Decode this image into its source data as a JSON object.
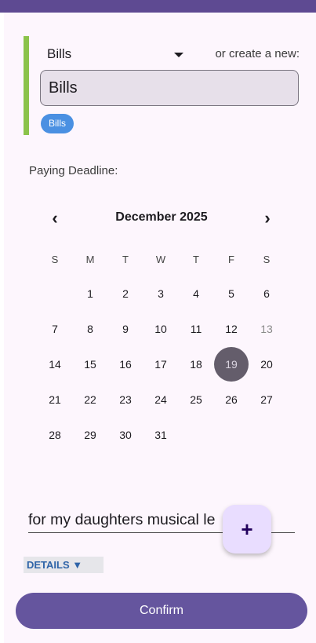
{
  "category": {
    "selected": "Bills",
    "create_label": "or create a new:",
    "name_value": "Bills",
    "chip_label": "Bills",
    "accent_color": "#8bc34a"
  },
  "deadline": {
    "label": "Paying Deadline:",
    "month_title": "December 2025",
    "prev_icon": "chevron-left-icon",
    "next_icon": "chevron-right-icon",
    "weekdays": [
      "S",
      "M",
      "T",
      "W",
      "T",
      "F",
      "S"
    ],
    "weeks": [
      [
        "",
        "1",
        "2",
        "3",
        "4",
        "5",
        "6"
      ],
      [
        "7",
        "8",
        "9",
        "10",
        "11",
        "12",
        "13"
      ],
      [
        "14",
        "15",
        "16",
        "17",
        "18",
        "19",
        "20"
      ],
      [
        "21",
        "22",
        "23",
        "24",
        "25",
        "26",
        "27"
      ],
      [
        "28",
        "29",
        "30",
        "31",
        "",
        "",
        ""
      ]
    ],
    "selected_day": "19",
    "muted_day": "13"
  },
  "note": {
    "value": "for my daughters musical le"
  },
  "fab_icon": "plus-icon",
  "details_label": "DETAILS ▼",
  "confirm_label": "Confirm"
}
